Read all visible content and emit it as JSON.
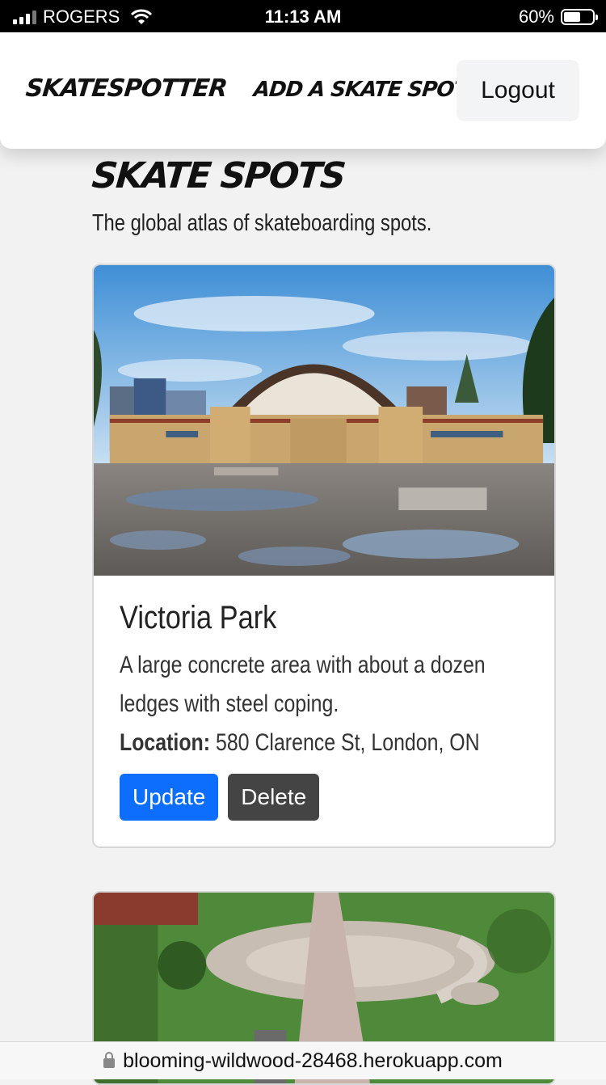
{
  "status_bar": {
    "carrier": "ROGERS",
    "time": "11:13 AM",
    "battery_percent": "60%",
    "battery_level": 0.6,
    "signal_bars_active": 3,
    "icons": [
      "signal-icon",
      "wifi-icon",
      "battery-icon"
    ]
  },
  "nav": {
    "brand": "SKATESPOTTER",
    "add_link": "ADD A SKATE SPOT",
    "logout_label": "Logout"
  },
  "page": {
    "title": "SKATE SPOTS",
    "subtitle": "The global atlas of skateboarding spots."
  },
  "spots": [
    {
      "name": "Victoria Park",
      "description": "A large concrete area with about a dozen ledges with steel coping.",
      "location_label": "Location:",
      "location": "580 Clarence St, London, ON",
      "update_label": "Update",
      "delete_label": "Delete"
    }
  ],
  "browser": {
    "url": "blooming-wildwood-28468.herokuapp.com",
    "icon": "lock-icon"
  },
  "colors": {
    "primary": "#0d6efd",
    "secondary": "#444444",
    "background": "#f2f2f2"
  }
}
